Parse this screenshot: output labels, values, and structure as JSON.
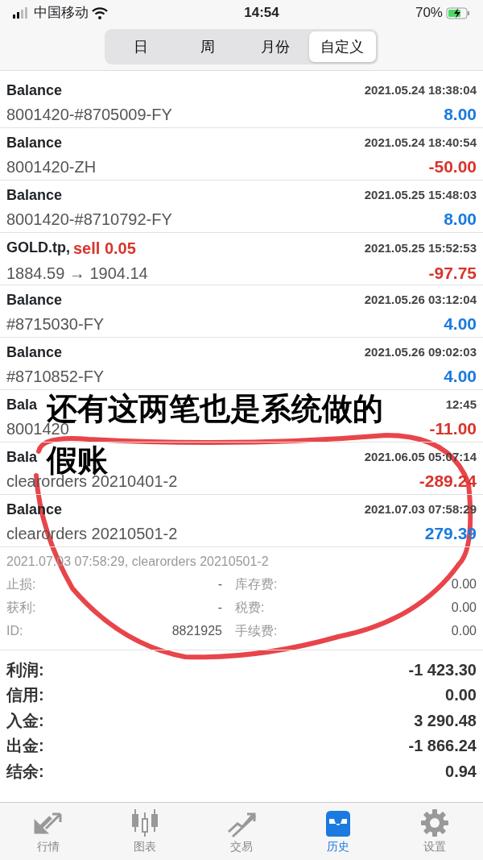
{
  "status_bar": {
    "carrier": "中国移动",
    "time": "14:54",
    "battery": "70%"
  },
  "periods": [
    {
      "label": "日",
      "selected": false
    },
    {
      "label": "周",
      "selected": false
    },
    {
      "label": "月份",
      "selected": false
    },
    {
      "label": "自定义",
      "selected": true
    }
  ],
  "records": [
    {
      "title": "Balance",
      "time": "2021.05.24 18:38:04",
      "subtitle": "8001420-#8705009-FY",
      "amount": "8.00",
      "color": "#1a7ae0"
    },
    {
      "title": "Balance",
      "time": "2021.05.24 18:40:54",
      "subtitle": "8001420-ZH",
      "amount": "-50.00",
      "color": "#d9342b"
    },
    {
      "title": "Balance",
      "time": "2021.05.25 15:48:03",
      "subtitle": "8001420-#8710792-FY",
      "amount": "8.00",
      "color": "#1a7ae0"
    },
    {
      "title": "GOLD.tp,",
      "order": "sell 0.05",
      "time": "2021.05.25 15:52:53",
      "subtitle": "1884.59 → 1904.14",
      "amount": "-97.75",
      "color": "#d9342b"
    },
    {
      "title": "Balance",
      "time": "2021.05.26 03:12:04",
      "subtitle": "#8715030-FY",
      "amount": "4.00",
      "color": "#1a7ae0"
    },
    {
      "title": "Balance",
      "time": "2021.05.26 09:02:03",
      "subtitle": "#8710852-FY",
      "amount": "4.00",
      "color": "#1a7ae0"
    },
    {
      "title": "Bala",
      "time": "12:45",
      "subtitle": "8001420",
      "amount": "-11.00",
      "color": "#d9342b"
    },
    {
      "title": "Bala",
      "time": "2021.06.05 05:07:14",
      "subtitle": "clearorders 20210401-2",
      "amount": "-289.24",
      "color": "#d9342b"
    },
    {
      "title": "Balance",
      "time": "2021.07.03 07:58:29",
      "subtitle": "clearorders 20210501-2",
      "amount": "279.39",
      "color": "#1a7ae0"
    }
  ],
  "detail": {
    "text": "2021.07.03 07:58:29, clearorders 20210501-2",
    "fields": [
      {
        "label": "止损:",
        "value": "-",
        "label_2": "库存费:",
        "value_2": "0.00"
      },
      {
        "label": "获利:",
        "value": "-",
        "label_2": "税费:",
        "value_2": "0.00"
      },
      {
        "label": "ID:",
        "value": "8821925",
        "label_2": "手续费:",
        "value_2": "0.00"
      }
    ]
  },
  "summary": [
    {
      "label": "利润:",
      "value": "-1 423.30"
    },
    {
      "label": "信用:",
      "value": "0.00"
    },
    {
      "label": "入金:",
      "value": "3 290.48"
    },
    {
      "label": "出金:",
      "value": "-1 866.24"
    },
    {
      "label": "结余:",
      "value": "0.94"
    }
  ],
  "tab_bar": [
    {
      "label": "行情",
      "selected": false
    },
    {
      "label": "图表",
      "selected": false
    },
    {
      "label": "交易",
      "selected": false
    },
    {
      "label": "历史",
      "selected": true
    },
    {
      "label": "设置",
      "selected": false
    }
  ],
  "annotation": {
    "lines": [
      "还有这两笔也是系统做的",
      "假账"
    ]
  }
}
